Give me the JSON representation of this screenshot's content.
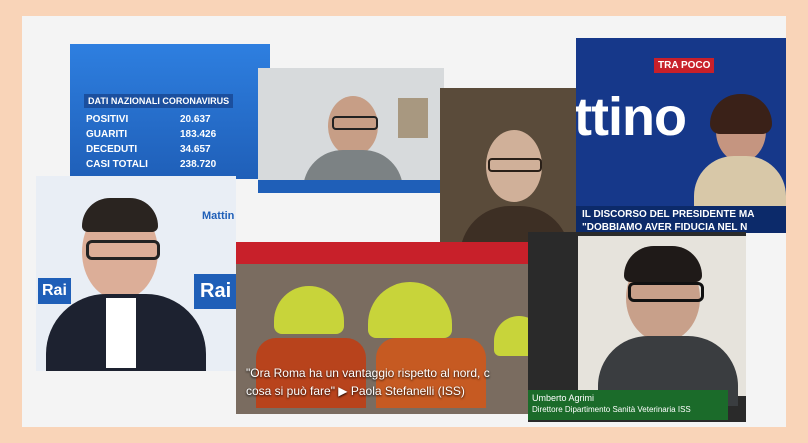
{
  "stats_panel": {
    "title": "DATI NAZIONALI CORONAVIRUS",
    "rows": [
      {
        "label": "POSITIVI",
        "value": "20.637"
      },
      {
        "label": "GUARITI",
        "value": "183.426"
      },
      {
        "label": "DECEDUTI",
        "value": "34.657"
      },
      {
        "label": "CASI TOTALI",
        "value": "238.720"
      }
    ]
  },
  "mattino_panel": {
    "headline": "ttino",
    "tag": "TRA POCO",
    "ticker_line1": "IL DISCORSO DEL PRESIDENTE MA",
    "ticker_line2": "\"DOBBIAMO AVER FIDUCIA NEL N"
  },
  "speaker_panel": {
    "logo_text": "Rai",
    "side_text": "Mattin"
  },
  "radio_panel": {
    "caption_line1": "\"Ora Roma ha un vantaggio rispetto al nord, c",
    "caption_line2": "cosa si può fare\" ▶ Paola Stefanelli (ISS)"
  },
  "guest_panel": {
    "name": "Umberto Agrimi",
    "role": "Direttore Dipartimento Sanità Veterinaria ISS"
  },
  "colors": {
    "border": "#f9d4b8",
    "rai_blue": "#1f5fb8",
    "news_red": "#c8202a",
    "helmet_yellow": "#c8d43a"
  }
}
